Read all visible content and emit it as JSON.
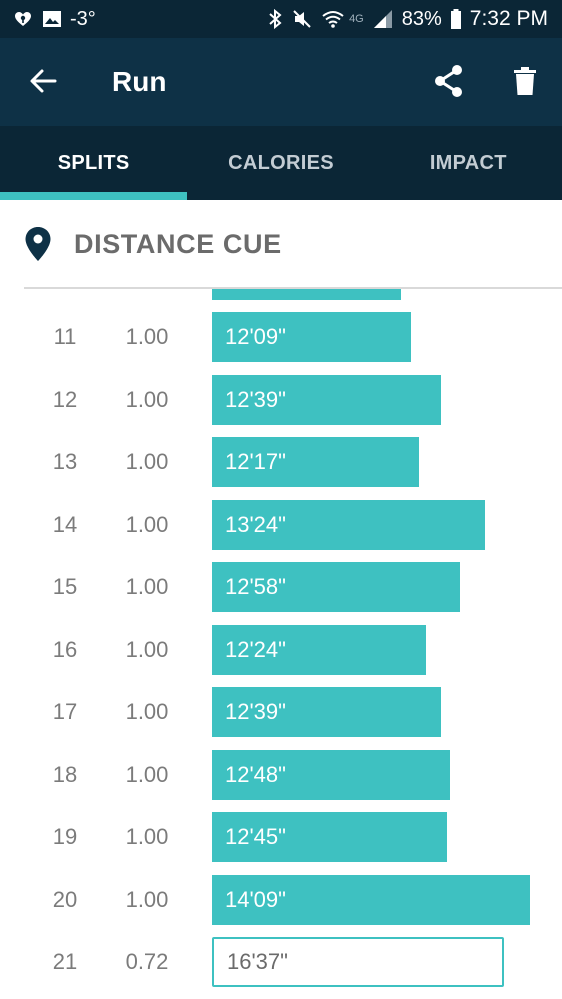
{
  "status_bar": {
    "temperature": "-3°",
    "network_label": "4G",
    "battery": "83%",
    "time": "7:32 PM",
    "icons": [
      "radio-icon",
      "image-icon",
      "bluetooth-icon",
      "mute-icon",
      "wifi-icon",
      "signal-icon",
      "battery-icon"
    ]
  },
  "app_bar": {
    "title": "Run",
    "icons": [
      "back-arrow-icon",
      "share-icon",
      "trash-icon"
    ]
  },
  "tabs": [
    {
      "label": "SPLITS",
      "active": true
    },
    {
      "label": "CALORIES",
      "active": false
    },
    {
      "label": "IMPACT",
      "active": false
    }
  ],
  "section": {
    "title": "DISTANCE CUE",
    "icon": "location-pin-icon"
  },
  "splits": [
    {
      "index": "11",
      "distance": "1.00",
      "time": "12'09\"",
      "seconds": 729
    },
    {
      "index": "12",
      "distance": "1.00",
      "time": "12'39\"",
      "seconds": 759
    },
    {
      "index": "13",
      "distance": "1.00",
      "time": "12'17\"",
      "seconds": 737
    },
    {
      "index": "14",
      "distance": "1.00",
      "time": "13'24\"",
      "seconds": 804
    },
    {
      "index": "15",
      "distance": "1.00",
      "time": "12'58\"",
      "seconds": 778
    },
    {
      "index": "16",
      "distance": "1.00",
      "time": "12'24\"",
      "seconds": 744
    },
    {
      "index": "17",
      "distance": "1.00",
      "time": "12'39\"",
      "seconds": 759
    },
    {
      "index": "18",
      "distance": "1.00",
      "time": "12'48\"",
      "seconds": 768
    },
    {
      "index": "19",
      "distance": "1.00",
      "time": "12'45\"",
      "seconds": 765
    },
    {
      "index": "20",
      "distance": "1.00",
      "time": "14'09\"",
      "seconds": 849
    },
    {
      "index": "21",
      "distance": "0.72",
      "time": "16'37\"",
      "seconds": 997,
      "partial": true
    }
  ],
  "colors": {
    "status_bar_bg": "#0b2636",
    "app_bar_bg": "#0e3146",
    "accent": "#3ec1c1",
    "text_gray": "#7b7b7b"
  }
}
